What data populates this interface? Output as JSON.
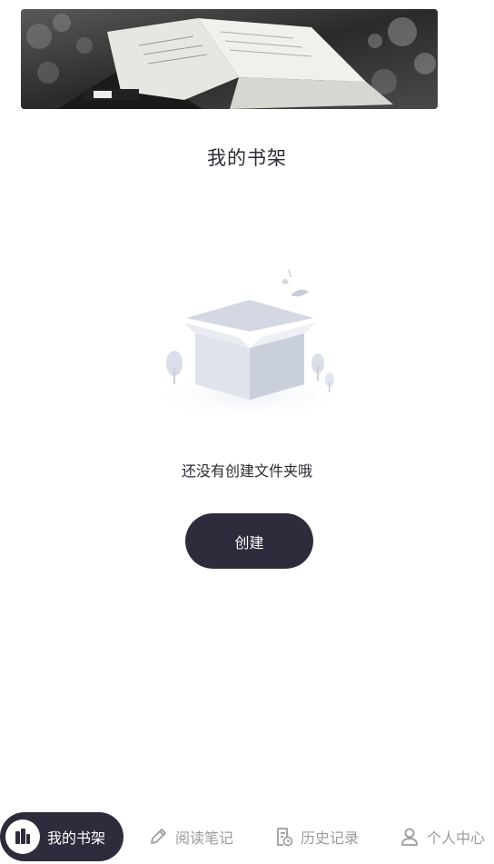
{
  "page": {
    "title": "我的书架",
    "empty_message": "还没有创建文件夹哦",
    "create_label": "创建"
  },
  "tabs": [
    {
      "label": "我的书架",
      "icon": "bookshelf-icon",
      "active": true
    },
    {
      "label": "阅读笔记",
      "icon": "pencil-icon",
      "active": false
    },
    {
      "label": "历史记录",
      "icon": "history-document-icon",
      "active": false
    },
    {
      "label": "个人中心",
      "icon": "user-icon",
      "active": false
    }
  ],
  "colors": {
    "accent": "#2d2c3c",
    "inactive_tab_text": "#9a9aa2"
  }
}
